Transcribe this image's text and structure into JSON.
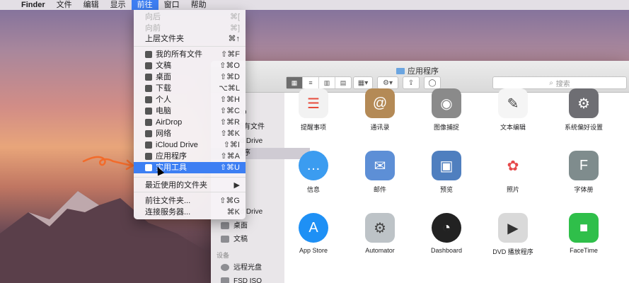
{
  "menubar": {
    "apple": "",
    "items": [
      "Finder",
      "文件",
      "编辑",
      "显示",
      "前往",
      "窗口",
      "帮助"
    ],
    "active_index": 4
  },
  "window": {
    "title": "应用程序",
    "search_placeholder": "搜索"
  },
  "sidebar": {
    "items": [
      {
        "label": "rop"
      },
      {
        "label": "所有文件"
      },
      {
        "label": "ud Drive"
      },
      {
        "label": "程序"
      },
      {
        "label": "ud Drive"
      },
      {
        "label": "桌面"
      },
      {
        "label": "文稿"
      }
    ],
    "devices_header": "设备",
    "devices": [
      {
        "label": "远程光盘"
      },
      {
        "label": "FSD ISO"
      }
    ]
  },
  "apps": [
    {
      "label": "提醒事项",
      "color": "#f2f2f2",
      "glyph": "☰",
      "fg": "#e74c3c"
    },
    {
      "label": "通讯录",
      "color": "#b48a56",
      "glyph": "@",
      "fg": "#fff"
    },
    {
      "label": "图像捕捉",
      "color": "#8a8a8a",
      "glyph": "◉",
      "fg": "#fff"
    },
    {
      "label": "文本编辑",
      "color": "#f5f5f5",
      "glyph": "✎",
      "fg": "#444"
    },
    {
      "label": "系统偏好设置",
      "color": "#6e6e73",
      "glyph": "⚙",
      "fg": "#fff"
    },
    {
      "label": "信息",
      "color": "#3b9cf0",
      "glyph": "…",
      "fg": "#fff"
    },
    {
      "label": "邮件",
      "color": "#5d8fd6",
      "glyph": "✉",
      "fg": "#fff"
    },
    {
      "label": "预览",
      "color": "#4f7fbf",
      "glyph": "▣",
      "fg": "#fff"
    },
    {
      "label": "照片",
      "color": "#ffffff",
      "glyph": "✿",
      "fg": "#e6494b"
    },
    {
      "label": "字体册",
      "color": "#7f8c8d",
      "glyph": "F",
      "fg": "#fff"
    },
    {
      "label": "App Store",
      "color": "#1e90f5",
      "glyph": "A",
      "fg": "#fff"
    },
    {
      "label": "Automator",
      "color": "#bdc3c7",
      "glyph": "⚙",
      "fg": "#444"
    },
    {
      "label": "Dashboard",
      "color": "#222",
      "glyph": "◔",
      "fg": "#fff"
    },
    {
      "label": "DVD 播放程序",
      "color": "#d9d9d9",
      "glyph": "▶",
      "fg": "#333"
    },
    {
      "label": "FaceTime",
      "color": "#2fbf4a",
      "glyph": "■",
      "fg": "#fff"
    }
  ],
  "menu": {
    "rows": [
      {
        "label": "向后",
        "sc": "⌘[",
        "dis": true
      },
      {
        "label": "向前",
        "sc": "⌘]",
        "dis": true
      },
      {
        "label": "上层文件夹",
        "sc": "⌘↑"
      },
      {
        "label": "我的所有文件",
        "sc": "⇧⌘F",
        "icon": true
      },
      {
        "label": "文稿",
        "sc": "⇧⌘O",
        "icon": true
      },
      {
        "label": "桌面",
        "sc": "⇧⌘D",
        "icon": true
      },
      {
        "label": "下载",
        "sc": "⌥⌘L",
        "icon": true
      },
      {
        "label": "个人",
        "sc": "⇧⌘H",
        "icon": true
      },
      {
        "label": "电脑",
        "sc": "⇧⌘C",
        "icon": true
      },
      {
        "label": "AirDrop",
        "sc": "⇧⌘R",
        "icon": true
      },
      {
        "label": "网络",
        "sc": "⇧⌘K",
        "icon": true
      },
      {
        "label": "iCloud Drive",
        "sc": "⇧⌘I",
        "icon": true
      },
      {
        "label": "应用程序",
        "sc": "⇧⌘A",
        "icon": true
      },
      {
        "label": "实用工具",
        "sc": "⇧⌘U",
        "icon": true,
        "hl": true
      },
      {
        "label": "最近使用的文件夹",
        "sc": "▶"
      },
      {
        "label": "前往文件夹...",
        "sc": "⇧⌘G"
      },
      {
        "label": "连接服务器...",
        "sc": "⌘K"
      }
    ]
  }
}
